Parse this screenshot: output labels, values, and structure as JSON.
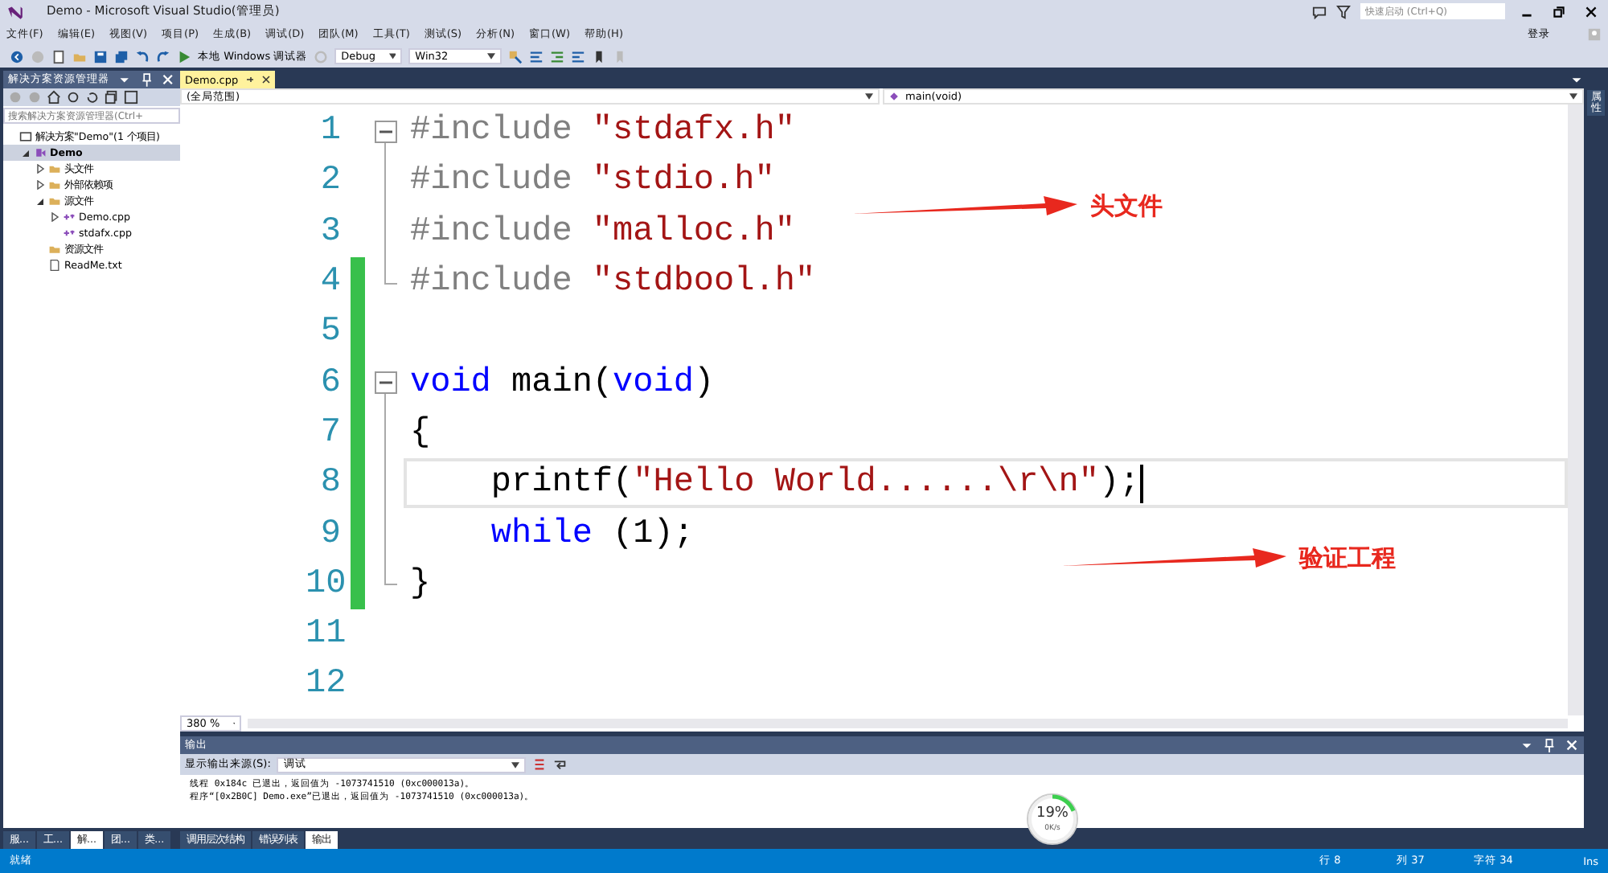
{
  "window": {
    "title": "Demo - Microsoft Visual Studio(管理员)",
    "quick_launch": {
      "placeholder": "快速启动 (Ctrl+Q)"
    },
    "sign_in": "登录"
  },
  "menu": [
    "文件(F)",
    "编辑(E)",
    "视图(V)",
    "项目(P)",
    "生成(B)",
    "调试(D)",
    "团队(M)",
    "工具(T)",
    "测试(S)",
    "分析(N)",
    "窗口(W)",
    "帮助(H)"
  ],
  "toolbar": {
    "debugger": "本地 Windows 调试器",
    "configuration": "Debug",
    "platform": "Win32"
  },
  "solution_explorer": {
    "title": "解决方案资源管理器",
    "search": {
      "placeholder": "搜索解决方案资源管理器(Ctrl+"
    },
    "tree": [
      {
        "label": "解决方案\"Demo\"(1 个项目)",
        "kind": "solution",
        "selected": false,
        "children": [
          {
            "label": "Demo",
            "kind": "project",
            "selected": true,
            "expanded": true,
            "children": [
              {
                "label": "头文件",
                "kind": "folder",
                "selected": false,
                "expanded": false
              },
              {
                "label": "外部依赖项",
                "kind": "folder",
                "selected": false,
                "expanded": false
              },
              {
                "label": "源文件",
                "kind": "folder",
                "selected": false,
                "expanded": true,
                "children": [
                  {
                    "label": "Demo.cpp",
                    "kind": "cpp",
                    "selected": false,
                    "expanded": false
                  },
                  {
                    "label": "stdafx.cpp",
                    "kind": "cpp",
                    "selected": false
                  }
                ]
              },
              {
                "label": "资源文件",
                "kind": "folder",
                "selected": false
              },
              {
                "label": "ReadMe.txt",
                "kind": "text",
                "selected": false
              }
            ]
          }
        ]
      }
    ],
    "tabs": [
      {
        "label": "服...",
        "selected": false
      },
      {
        "label": "工...",
        "selected": false
      },
      {
        "label": "解...",
        "selected": true
      },
      {
        "label": "团...",
        "selected": false
      },
      {
        "label": "类...",
        "selected": false
      }
    ]
  },
  "editor": {
    "tabs": [
      {
        "label": "Demo.cpp",
        "selected": true
      }
    ],
    "scope": "(全局范围)",
    "member": "main(void)",
    "zoom": "380 %",
    "lines": [
      {
        "number": "1",
        "expanded": true,
        "changed": false,
        "current": false,
        "tokens": [
          {
            "kind": "pp",
            "text": "#include "
          },
          {
            "kind": "str",
            "text": "\"stdafx.h\""
          }
        ]
      },
      {
        "number": "2",
        "changed": false,
        "current": false,
        "tokens": [
          {
            "kind": "pp",
            "text": "#include "
          },
          {
            "kind": "str",
            "text": "\"stdio.h\""
          }
        ],
        "note": "头文件"
      },
      {
        "number": "3",
        "changed": false,
        "current": false,
        "tokens": [
          {
            "kind": "pp",
            "text": "#include "
          },
          {
            "kind": "str",
            "text": "\"malloc.h\""
          }
        ]
      },
      {
        "number": "4",
        "changed": true,
        "current": false,
        "tokens": [
          {
            "kind": "pp",
            "text": "#include "
          },
          {
            "kind": "str",
            "text": "\"stdbool.h\""
          }
        ]
      },
      {
        "number": "5",
        "changed": true,
        "current": false
      },
      {
        "number": "6",
        "expanded": true,
        "changed": true,
        "current": false,
        "tokens": [
          {
            "kind": "kw",
            "text": "void"
          },
          {
            "kind": "plain",
            "text": " main("
          },
          {
            "kind": "kw",
            "text": "void"
          },
          {
            "kind": "plain",
            "text": ")"
          }
        ]
      },
      {
        "number": "7",
        "changed": true,
        "current": false,
        "tokens": [
          {
            "kind": "plain",
            "text": "{"
          }
        ]
      },
      {
        "number": "8",
        "changed": true,
        "current": true,
        "tokens": [
          {
            "kind": "plain",
            "text": "    printf("
          },
          {
            "kind": "str",
            "text": "\"Hello World......\\r\\n\""
          },
          {
            "kind": "plain",
            "text": ");"
          }
        ]
      },
      {
        "number": "9",
        "changed": true,
        "current": false,
        "tokens": [
          {
            "kind": "kw",
            "text": "    while"
          },
          {
            "kind": "plain",
            "text": " (1);"
          }
        ],
        "note": "验证工程"
      },
      {
        "number": "10",
        "changed": true,
        "current": false,
        "tokens": [
          {
            "kind": "plain",
            "text": "}"
          }
        ]
      },
      {
        "number": "11",
        "changed": false,
        "current": false
      },
      {
        "number": "12",
        "changed": false,
        "current": false
      }
    ]
  },
  "properties_tab": "属性",
  "output": {
    "title": "输出",
    "source_label": "显示输出来源(S):",
    "source": "调试",
    "lines": [
      "线程 0x184c 已退出，返回值为 -1073741510 (0xc000013a)。",
      "程序“[0x2B0C] Demo.exe”已退出，返回值为 -1073741510 (0xc000013a)。"
    ],
    "tabs": [
      {
        "label": "调用层次结构",
        "selected": false
      },
      {
        "label": "错误列表",
        "selected": false
      },
      {
        "label": "输出",
        "selected": true
      }
    ]
  },
  "speed_widget": {
    "percent": "19%",
    "level": 0.19,
    "rate": "0K/s"
  },
  "status_bar": {
    "message": "就绪",
    "line": "行 8",
    "column": "列 37",
    "char": "字符 34",
    "mode": "Ins"
  }
}
